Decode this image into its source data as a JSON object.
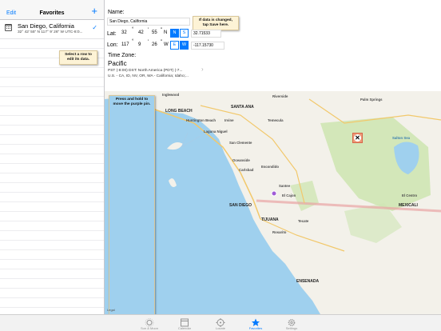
{
  "sidebar": {
    "edit_label": "Edit",
    "title": "Favorites",
    "add_label": "+",
    "items": [
      {
        "name": "San Diego, California",
        "detail": "32° 42' 55\" N  117° 9' 26\" W  UTC-8:0...",
        "selected": true
      }
    ],
    "note": "Select a row to edit its data."
  },
  "details": {
    "name_label": "Name:",
    "name_value": "San Diego, California",
    "note": "If data is changed, tap Save here.",
    "lat_label": "Lat:",
    "lat_deg": "32",
    "lat_min": "42",
    "lat_sec": "55",
    "lat_dir": "N",
    "lat_opt_n": "N",
    "lat_opt_s": "S",
    "lat_decimal": "32.71533",
    "lon_label": "Lon:",
    "lon_deg": "117",
    "lon_min": "9",
    "lon_sec": "26",
    "lon_dir": "W",
    "lon_opt_e": "E",
    "lon_opt_w": "W",
    "lon_decimal": "-117.15730",
    "deg_symbol": "°",
    "min_symbol": "'",
    "sec_symbol": "\"",
    "timezone_label": "Time Zone:",
    "timezone_name": "Pacific",
    "timezone_detail": "PST (-8:00)  DST: North America (PDT) (-7...",
    "timezone_regions": "U.S. - CA, ID, NV, OR, WA - California; Idaho;..."
  },
  "map": {
    "note": "Press and hold to move the purple pin.",
    "legal": "Legal",
    "labels": {
      "inglewood": "Inglewood",
      "santa_ana": "SANTA ANA",
      "long_beach": "LONG BEACH",
      "huntington_beach": "Huntington Beach",
      "irvine": "Irvine",
      "laguna_niguel": "Laguna Niguel",
      "temecula": "Temecula",
      "oceanside": "Oceanside",
      "escondido": "Escondido",
      "san_diego": "SAN DIEGO",
      "el_cajon": "El Cajon",
      "tijuana": "TIJUANA",
      "mexicali": "MEXICALI",
      "ensenada": "ENSENADA",
      "palm_springs": "Palm Springs",
      "salton_sea": "Salton Sea",
      "el_centro": "El Centro",
      "riverside": "Riverside",
      "san_clemente": "San Clemente",
      "carlsbad": "Carlsbad",
      "santee": "Santee",
      "rosarito": "Rosarito",
      "tecate": "Tecate"
    }
  },
  "tabs": [
    {
      "label": "Sun & Moon",
      "icon": "sun-icon",
      "active": false
    },
    {
      "label": "Calendar",
      "icon": "calendar-icon",
      "active": false
    },
    {
      "label": "Locate",
      "icon": "locate-icon",
      "active": false
    },
    {
      "label": "Favorites",
      "icon": "star-icon",
      "active": true
    },
    {
      "label": "Settings",
      "icon": "gear-icon",
      "active": false
    }
  ],
  "colors": {
    "accent": "#007aff",
    "note_bg": "#fdf3d6",
    "water": "#9fd0ee",
    "land": "#f3f1ea",
    "park": "#cfe6b4"
  }
}
